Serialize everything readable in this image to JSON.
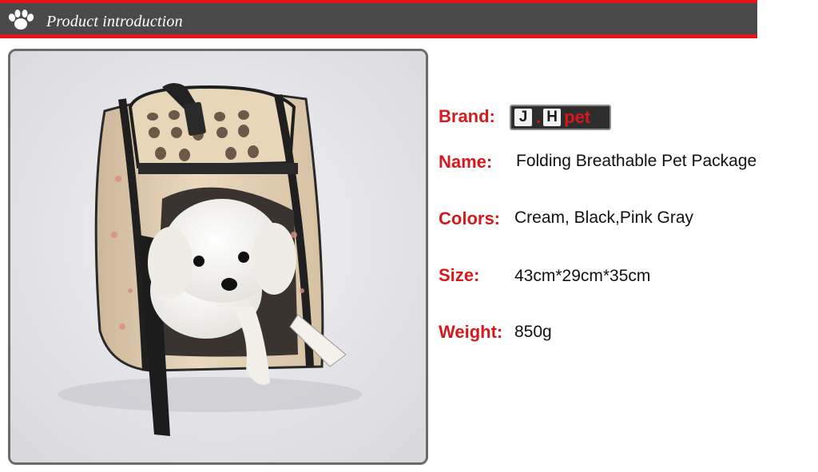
{
  "header": {
    "title": "Product introduction",
    "icon": "paw-icon"
  },
  "photo": {
    "subject": "product-photo"
  },
  "brand_logo": {
    "letter_1": "J",
    "separator": ".",
    "letter_2": "H",
    "suffix": "pet"
  },
  "specs": {
    "brand_label": "Brand:",
    "name_label": "Name:",
    "name_value": "Folding Breathable Pet Package",
    "colors_label": "Colors:",
    "colors_value": "Cream, Black,Pink Gray",
    "size_label": "Size:",
    "size_value": "43cm*29cm*35cm",
    "weight_label": "Weight:",
    "weight_value": "850g"
  },
  "colors": {
    "accent": "#e8141c",
    "header_bg": "#4a4a4a",
    "label": "#d7191c"
  }
}
